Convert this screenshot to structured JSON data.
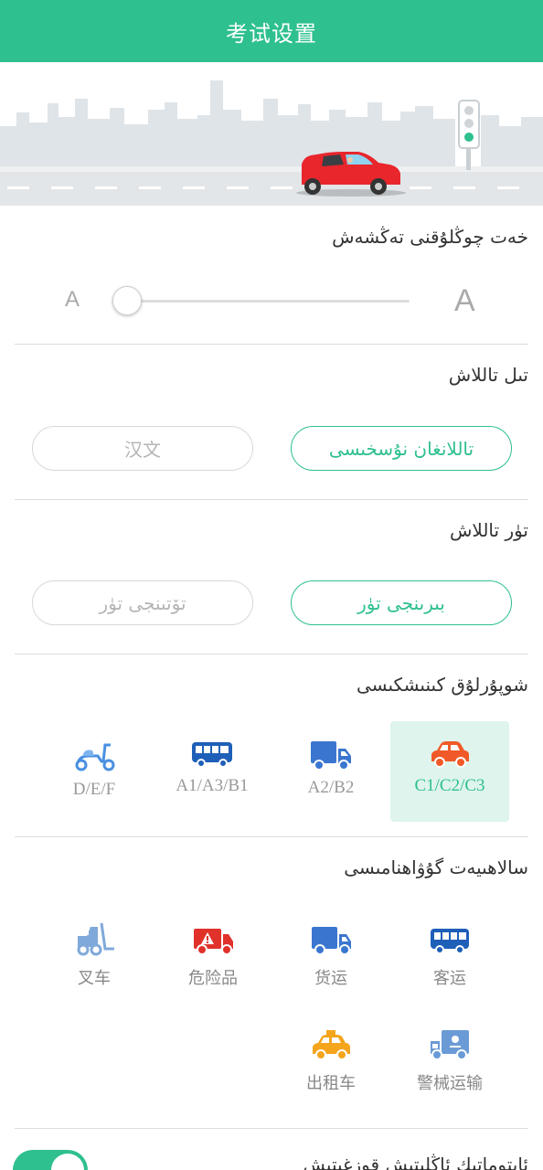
{
  "header": {
    "title": "考试设置"
  },
  "font_size": {
    "title": "خەت چوڭلۇقنى تەڭشەش",
    "small_label": "A",
    "large_label": "A",
    "level": 0
  },
  "language": {
    "title": "تىل تاللاش",
    "options": [
      {
        "label": "تاللانغان نۇسخىسى",
        "selected": true
      },
      {
        "label": "汉文",
        "selected": false
      }
    ]
  },
  "category": {
    "title": "تۈر تاللاش",
    "options": [
      {
        "label": "بىرىنجى تۈر",
        "selected": true
      },
      {
        "label": "تۆتىنجى تۈر",
        "selected": false
      }
    ]
  },
  "vehicle": {
    "title": "شوپۇرلۇق كىنىشكىسى",
    "types": [
      {
        "label": "C1/C2/C3",
        "icon": "car-icon",
        "selected": true
      },
      {
        "label": "A2/B2",
        "icon": "truck-icon",
        "selected": false
      },
      {
        "label": "A1/A3/B1",
        "icon": "bus-icon",
        "selected": false
      },
      {
        "label": "D/E/F",
        "icon": "scooter-icon",
        "selected": false
      }
    ]
  },
  "certificate": {
    "title": "سالاھىيەت گۇۋاھنامىسى",
    "items": [
      {
        "label": "叉车",
        "icon": "forklift-icon"
      },
      {
        "label": "危险品",
        "icon": "hazmat-truck-icon"
      },
      {
        "label": "货运",
        "icon": "cargo-truck-icon"
      },
      {
        "label": "客运",
        "icon": "passenger-bus-icon"
      },
      {
        "label": "出租车",
        "icon": "taxi-icon"
      },
      {
        "label": "警械运输",
        "icon": "police-transport-icon"
      }
    ]
  },
  "auto_play": {
    "title": "ئاپتوماتىك ئاڭلىتىش قوزغىتىش",
    "enabled": true
  },
  "colors": {
    "accent": "#2ec08e",
    "selected_tile_bg": "#def4ec",
    "car_red": "#e8262c",
    "vehicle_orange": "#f05a28",
    "vehicle_blue": "#3a76d0",
    "taxi_yellow": "#f4a51c"
  }
}
